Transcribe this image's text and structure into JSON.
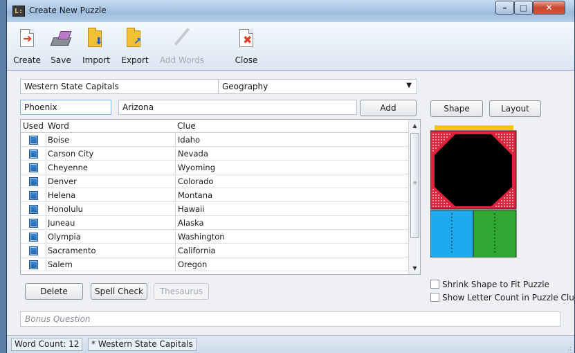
{
  "window": {
    "title": "Create New Puzzle",
    "app_icon_text": "L:",
    "minimize": "–",
    "maximize": "□",
    "close": "✕"
  },
  "toolbar": {
    "create": "Create",
    "save": "Save",
    "import": "Import",
    "export": "Export",
    "add_words": "Add Words",
    "close": "Close"
  },
  "puzzle": {
    "title_value": "Western State Capitals",
    "category_value": "Geography",
    "category_caret": "▼"
  },
  "entry": {
    "word_value": "Phoenix",
    "clue_value": "Arizona",
    "add_label": "Add"
  },
  "shape_buttons": {
    "shape": "Shape",
    "layout": "Layout"
  },
  "table": {
    "headers": {
      "used": "Used",
      "word": "Word",
      "clue": "Clue"
    },
    "rows": [
      {
        "word": "Boise",
        "clue": "Idaho"
      },
      {
        "word": "Carson City",
        "clue": "Nevada"
      },
      {
        "word": "Cheyenne",
        "clue": "Wyoming"
      },
      {
        "word": "Denver",
        "clue": "Colorado"
      },
      {
        "word": "Helena",
        "clue": "Montana"
      },
      {
        "word": "Honolulu",
        "clue": "Hawaii"
      },
      {
        "word": "Juneau",
        "clue": "Alaska"
      },
      {
        "word": "Olympia",
        "clue": "Washington"
      },
      {
        "word": "Sacramento",
        "clue": "California"
      },
      {
        "word": "Salem",
        "clue": "Oregon"
      }
    ],
    "scroll_up": "▲",
    "scroll_down": "▼",
    "grip": "≡"
  },
  "actions": {
    "delete": "Delete",
    "spell_check": "Spell Check",
    "thesaurus": "Thesaurus"
  },
  "options": {
    "shrink_shape": "Shrink Shape to Fit Puzzle",
    "show_letter_count": "Show Letter Count in Puzzle Clues"
  },
  "bonus": {
    "placeholder": "Bonus Question"
  },
  "status": {
    "word_count": "Word Count: 12",
    "file": "* Western State Capitals",
    "grip": ".:"
  },
  "colors": {
    "shape_red": "#e0233f",
    "shape_black": "#000000",
    "shape_yellow": "#f5c518",
    "shape_blue": "#1fa9ee",
    "shape_green": "#2ea832"
  }
}
